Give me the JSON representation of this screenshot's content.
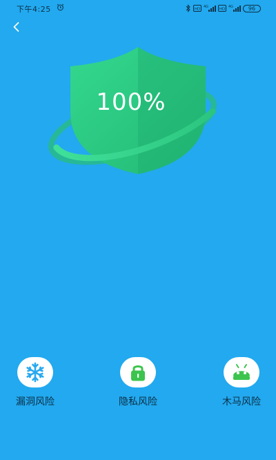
{
  "status_bar": {
    "time": "下午4:25",
    "battery": "96"
  },
  "header": {
    "back_icon": "chevron-left-icon"
  },
  "shield": {
    "percent_text": "100%",
    "icon": "shield-icon",
    "color": "#2fcf8a"
  },
  "risks": [
    {
      "label": "漏洞风险",
      "icon": "snowflake-icon",
      "color": "#29a8f0"
    },
    {
      "label": "隐私风险",
      "icon": "lock-icon",
      "color": "#3cc44e"
    },
    {
      "label": "木马风险",
      "icon": "android-icon",
      "color": "#3cc44e"
    }
  ],
  "colors": {
    "background": "#22a9ef",
    "accent_green": "#2fcf8a"
  }
}
